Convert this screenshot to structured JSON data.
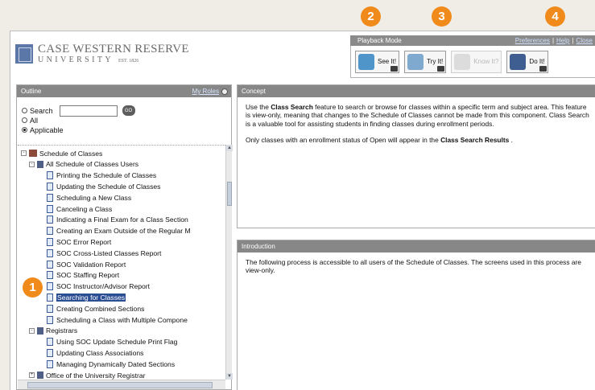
{
  "logo": {
    "name": "CASE WESTERN RESERVE",
    "sub": "UNIVERSITY",
    "est": "EST. 1826"
  },
  "playback": {
    "title": "Playback Mode",
    "links": [
      "Preferences",
      "Help",
      "Close"
    ],
    "separator": "|",
    "modes": [
      {
        "label": "See It!",
        "enabled": true
      },
      {
        "label": "Try It!",
        "enabled": true
      },
      {
        "label": "Know It?",
        "enabled": false
      },
      {
        "label": "Do It!",
        "enabled": true
      }
    ]
  },
  "outline": {
    "title": "Outline",
    "my_roles": "My Roles",
    "filter": {
      "search_label": "Search",
      "go": "GO",
      "all_label": "All",
      "applicable_label": "Applicable",
      "selected": "Applicable",
      "search_value": ""
    },
    "tree": [
      {
        "label": "Schedule of Classes",
        "type": "book",
        "toggle": "-"
      },
      {
        "label": "All Schedule of Classes Users",
        "type": "folder",
        "toggle": "-"
      },
      {
        "label": "Printing the Schedule of Classes",
        "type": "doc"
      },
      {
        "label": "Updating the Schedule of Classes",
        "type": "doc"
      },
      {
        "label": "Scheduling a New Class",
        "type": "doc"
      },
      {
        "label": "Canceling a Class",
        "type": "doc"
      },
      {
        "label": "Indicating a Final Exam for a Class Section",
        "type": "doc"
      },
      {
        "label": "Creating an Exam Outside of the Regular M",
        "type": "doc"
      },
      {
        "label": "SOC Error Report",
        "type": "doc"
      },
      {
        "label": "SOC Cross-Listed Classes Report",
        "type": "doc"
      },
      {
        "label": "SOC Validation Report",
        "type": "doc"
      },
      {
        "label": "SOC Staffing Report",
        "type": "doc"
      },
      {
        "label": "SOC Instructor/Advisor Report",
        "type": "doc"
      },
      {
        "label": "Searching for Classes",
        "type": "doc",
        "selected": true
      },
      {
        "label": "Creating Combined Sections",
        "type": "doc"
      },
      {
        "label": "Scheduling a Class with Multiple Compone",
        "type": "doc"
      },
      {
        "label": "Registrars",
        "type": "folder",
        "toggle": "-"
      },
      {
        "label": "Using SOC Update Schedule Print Flag",
        "type": "doc"
      },
      {
        "label": "Updating Class Associations",
        "type": "doc"
      },
      {
        "label": "Managing Dynamically Dated Sections",
        "type": "doc"
      },
      {
        "label": "Office of the University Registrar",
        "type": "folder",
        "toggle": "+"
      }
    ]
  },
  "concept": {
    "title": "Concept",
    "p1_pre": "Use the ",
    "p1_bold": "Class Search",
    "p1_post": " feature to search or browse for classes within a specific term and subject area. This feature is view-only, meaning that changes to the Schedule of Classes cannot be made from this component. Class Search is a valuable tool for assisting students in finding classes during enrollment periods.",
    "p2_pre": "Only classes with an enrollment status of Open will appear in the ",
    "p2_bold": "Class Search Results",
    "p2_post": " ."
  },
  "introduction": {
    "title": "Introduction",
    "p1": "The following process is accessible to all users of the Schedule of Classes. The screens used in this process are view-only."
  },
  "callouts": [
    "1",
    "2",
    "3",
    "4"
  ],
  "colors": {
    "accent": "#f08a1b",
    "header": "#878787",
    "selection": "#2b4e93"
  }
}
